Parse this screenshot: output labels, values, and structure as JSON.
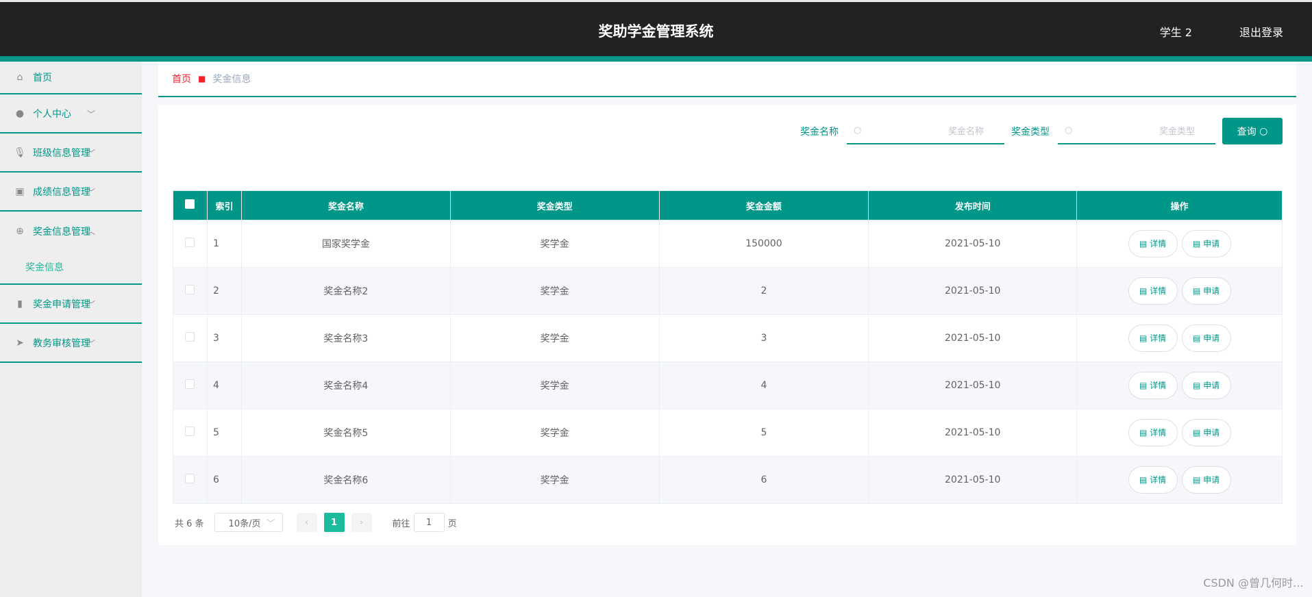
{
  "header": {
    "title": "奖助学金管理系统",
    "user": "学生 2",
    "logout": "退出登录"
  },
  "sidebar": {
    "items": [
      {
        "label": "首页",
        "icon": "home-icon"
      },
      {
        "label": "个人中心",
        "icon": "user-icon"
      },
      {
        "label": "班级信息管理",
        "icon": "microphone-icon"
      },
      {
        "label": "成绩信息管理",
        "icon": "clipboard-icon"
      },
      {
        "label": "奖金信息管理",
        "icon": "compass-icon"
      },
      {
        "label": "奖金申请管理",
        "icon": "bar-chart-icon"
      },
      {
        "label": "教务审核管理",
        "icon": "send-icon"
      }
    ],
    "submenu": "奖金信息"
  },
  "breadcrumb": {
    "home": "首页",
    "current": "奖金信息"
  },
  "search": {
    "name_label": "奖金名称",
    "name_placeholder": "奖金名称",
    "type_label": "奖金类型",
    "type_placeholder": "奖金类型",
    "button": "查询"
  },
  "table": {
    "headers": [
      "索引",
      "奖金名称",
      "奖金类型",
      "奖金金额",
      "发布时间",
      "操作"
    ],
    "rows": [
      [
        "1",
        "国家奖学金",
        "奖学金",
        "150000",
        "2021-05-10"
      ],
      [
        "2",
        "奖金名称2",
        "奖学金",
        "2",
        "2021-05-10"
      ],
      [
        "3",
        "奖金名称3",
        "奖学金",
        "3",
        "2021-05-10"
      ],
      [
        "4",
        "奖金名称4",
        "奖学金",
        "4",
        "2021-05-10"
      ],
      [
        "5",
        "奖金名称5",
        "奖学金",
        "5",
        "2021-05-10"
      ],
      [
        "6",
        "奖金名称6",
        "奖学金",
        "6",
        "2021-05-10"
      ]
    ],
    "detail": "详情",
    "apply": "申请"
  },
  "pagination": {
    "total": "共 6 条",
    "page_size": "10条/页",
    "current": "1",
    "goto": "前往",
    "goto_value": "1",
    "page_unit": "页"
  },
  "watermark": "CSDN @曾几何时…",
  "colors": {
    "accent": "#009688",
    "header": "#222222"
  }
}
